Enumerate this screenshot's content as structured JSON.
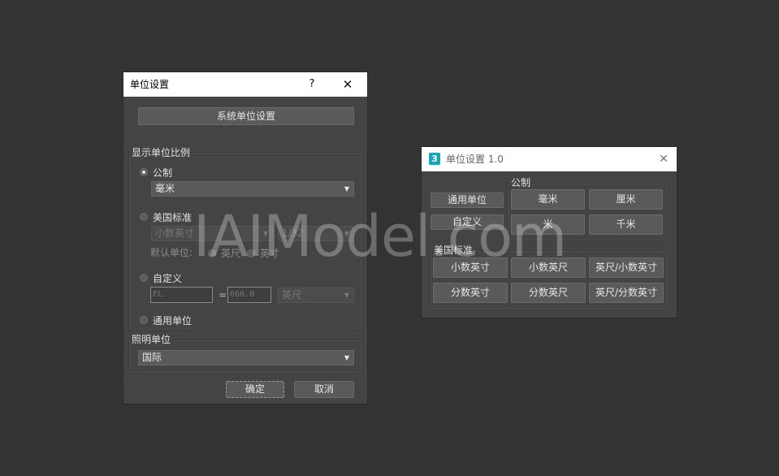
{
  "dialog1": {
    "title": "单位设置",
    "help_label": "?",
    "close_label": "✕",
    "system_units_button": "系统单位设置",
    "display_group": {
      "label": "显示单位比例",
      "metric": {
        "label": "公制",
        "selected": true,
        "value": "毫米"
      },
      "us": {
        "label": "美国标准",
        "selected": false,
        "format_value": "小数英寸",
        "fraction_value": "1/32",
        "default_unit_label": "默认单位:",
        "feet_label": "英尺",
        "inches_label": "英寸"
      },
      "custom": {
        "label": "自定义",
        "selected": false,
        "name_value": "FL",
        "equals": "=",
        "amount_value": "660.0",
        "unit_value": "英尺"
      },
      "generic": {
        "label": "通用单位",
        "selected": false
      }
    },
    "lighting_group": {
      "label": "照明单位",
      "value": "国际"
    },
    "ok_label": "确定",
    "cancel_label": "取消"
  },
  "dialog2": {
    "title": "单位设置 1.0",
    "app_icon_label": "3",
    "close_label": "✕",
    "generic_button": "通用单位",
    "custom_button": "自定义",
    "metric_group": {
      "label": "公制",
      "buttons": [
        "毫米",
        "厘米",
        "米",
        "千米"
      ]
    },
    "us_group": {
      "label": "美国标准",
      "buttons": [
        "小数英寸",
        "小数英尺",
        "英尺/小数英寸",
        "分数英寸",
        "分数英尺",
        "英尺/分数英寸"
      ]
    }
  },
  "watermark": "IAIModel.com",
  "colors": {
    "background": "#333333",
    "dialog": "#444444",
    "button": "#5a5a5a",
    "titlebar": "#ffffff",
    "icon_accent": "#1aa6b7"
  }
}
